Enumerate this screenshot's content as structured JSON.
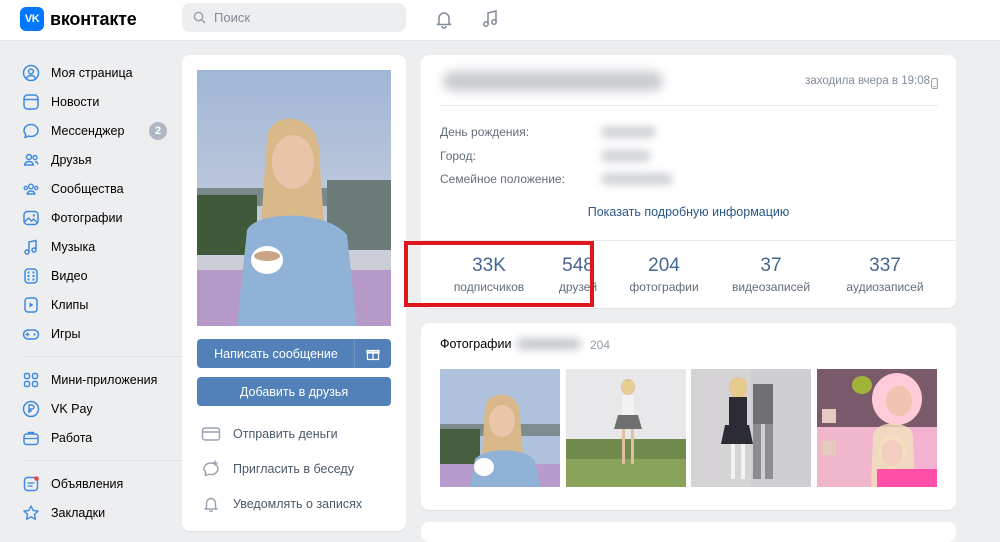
{
  "header": {
    "logo_mark": "VK",
    "logo_text": "вконтакте",
    "search_placeholder": "Поиск"
  },
  "sidebar": {
    "items": [
      {
        "label": "Моя страница",
        "icon": "user-circle-icon"
      },
      {
        "label": "Новости",
        "icon": "news-icon"
      },
      {
        "label": "Мессенджер",
        "icon": "message-icon",
        "badge": "2"
      },
      {
        "label": "Друзья",
        "icon": "friends-icon"
      },
      {
        "label": "Сообщества",
        "icon": "groups-icon"
      },
      {
        "label": "Фотографии",
        "icon": "photo-icon"
      },
      {
        "label": "Музыка",
        "icon": "music-icon"
      },
      {
        "label": "Видео",
        "icon": "video-icon"
      },
      {
        "label": "Клипы",
        "icon": "clips-icon"
      },
      {
        "label": "Игры",
        "icon": "gamepad-icon"
      }
    ],
    "items2": [
      {
        "label": "Мини-приложения",
        "icon": "apps-icon"
      },
      {
        "label": "VK Pay",
        "icon": "vkpay-icon"
      },
      {
        "label": "Работа",
        "icon": "briefcase-icon"
      }
    ],
    "items3": [
      {
        "label": "Объявления",
        "icon": "ads-icon"
      },
      {
        "label": "Закладки",
        "icon": "bookmark-icon"
      }
    ]
  },
  "profile_actions": {
    "message_button": "Написать сообщение",
    "add_friend_button": "Добавить в друзья",
    "send_money": "Отправить деньги",
    "invite_chat": "Пригласить в беседу",
    "notify_posts": "Уведомлять о записях"
  },
  "profile": {
    "last_seen": "заходила вчера в 19:08",
    "birthday_label": "День рождения:",
    "city_label": "Город:",
    "relationship_label": "Семейное положение:",
    "more_info": "Показать подробную информацию",
    "counters": [
      {
        "value": "33K",
        "caption": "подписчиков"
      },
      {
        "value": "548",
        "caption": "друзей"
      },
      {
        "value": "204",
        "caption": "фотографии"
      },
      {
        "value": "37",
        "caption": "видеозаписей"
      },
      {
        "value": "337",
        "caption": "аудиозаписей"
      }
    ]
  },
  "photos": {
    "title": "Фотографии",
    "count": "204"
  },
  "colors": {
    "accent": "#5181b8",
    "highlight": "#e0161e",
    "background": "#edeef0"
  }
}
